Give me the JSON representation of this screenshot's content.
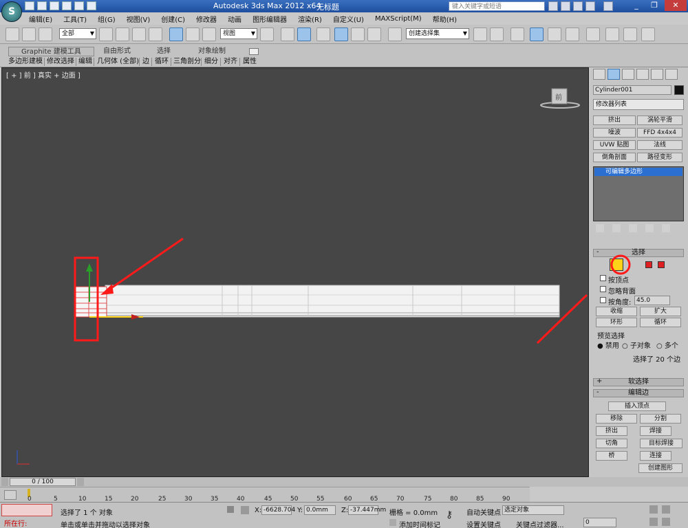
{
  "titlebar": {
    "app_title": "Autodesk 3ds Max  2012 x64",
    "doc_title": "无标题",
    "search_placeholder": "键入关键字或短语"
  },
  "app_button": {
    "label": "S"
  },
  "menu": [
    "编辑(E)",
    "工具(T)",
    "组(G)",
    "视图(V)",
    "创建(C)",
    "修改器",
    "动画",
    "图形编辑器",
    "渲染(R)",
    "自定义(U)",
    "MAXScript(M)",
    "帮助(H)"
  ],
  "toolbar": {
    "selection_filter": "全部",
    "reference_coord": "视图",
    "named_selection": "创建选择集"
  },
  "ribbon": {
    "tabs": [
      "Graphite 建模工具",
      "自由形式",
      "选择",
      "对象绘制"
    ],
    "subtabs": [
      "多边形建模",
      "修改选择",
      "编辑",
      "几何体 (全部)",
      "边",
      "循环",
      "三角剖分",
      "细分",
      "对齐",
      "属性"
    ]
  },
  "viewport": {
    "label": "[ + ] 前 ] 真实 + 边面 ]",
    "viewcube_label": "前"
  },
  "command_panel": {
    "object_name": "Cylinder001",
    "modifier_list": "修改器列表",
    "modifier_buttons": [
      "挤出",
      "涡轮平滑",
      "噪波",
      "FFD 4x4x4",
      "UVW 贴图",
      "法线",
      "倒角剖面",
      "路径变形"
    ],
    "stack_item": "可编辑多边形",
    "selection_rollout": "选择",
    "by_vertex": "按顶点",
    "ignore_backfacing": "忽略背面",
    "by_angle": "按角度:",
    "angle_value": "45.0",
    "shrink": "收缩",
    "grow": "扩大",
    "ring": "环形",
    "loop": "循环",
    "preview_title": "预览选择",
    "preview_disable": "禁用",
    "preview_subobj": "子对象",
    "preview_multi": "多个",
    "selected_text": "选择了 20 个边",
    "soft_selection": "软选择",
    "edit_edges": "编辑边",
    "insert_vertex": "插入顶点",
    "remove": "移除",
    "split": "分割",
    "extrude": "挤出",
    "weld": "焊接",
    "chamfer": "切角",
    "target_weld": "目标焊接",
    "bridge": "桥",
    "connect": "连接",
    "create_shape": "创建图形"
  },
  "timeline": {
    "frame_label": "0 / 100",
    "ticks": [
      "0",
      "5",
      "10",
      "15",
      "20",
      "25",
      "30",
      "35",
      "40",
      "45",
      "50",
      "55",
      "60",
      "65",
      "70",
      "75",
      "80",
      "85",
      "90"
    ]
  },
  "status": {
    "running": "所在行:",
    "selected_msg": "选择了 1 个 对象",
    "hint_msg": "单击或单击并拖动以选择对象",
    "x_label": "X:",
    "x_value": "-6628.704",
    "y_label": "Y:",
    "y_value": "0.0mm",
    "z_label": "Z:",
    "z_value": "-37.447mm",
    "grid": "栅格 = 0.0mm",
    "add_time_tag": "添加时间标记",
    "auto_key": "自动关键点",
    "set_key": "设置关键点",
    "selected_obj": "选定对象",
    "key_filters": "关键点过滤器...",
    "frame_value": "0"
  },
  "colors": {
    "viewport_bg": "#464646",
    "annotation_red": "#ff1a1a",
    "highlight_blue": "#2b6fd1"
  }
}
